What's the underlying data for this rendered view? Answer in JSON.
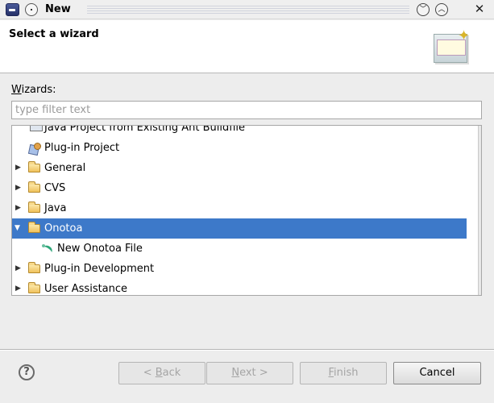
{
  "window": {
    "title": "New"
  },
  "header": {
    "title": "Select a wizard"
  },
  "wizards": {
    "label_prefix": "W",
    "label_rest": "izards:",
    "filter_placeholder": "type filter text",
    "filter_value": ""
  },
  "tree": {
    "items": [
      {
        "label": "Java Project from Existing Ant Buildfile",
        "expander": "",
        "icon": "java-project-icon"
      },
      {
        "label": "Plug-in Project",
        "expander": "",
        "icon": "plugin-project-icon"
      },
      {
        "label": "General",
        "expander": "▶",
        "icon": "folder-icon"
      },
      {
        "label": "CVS",
        "expander": "▶",
        "icon": "folder-icon"
      },
      {
        "label": "Java",
        "expander": "▶",
        "icon": "folder-icon"
      },
      {
        "label": "Onotoa",
        "expander": "▼",
        "icon": "folder-open-icon",
        "selected": true
      },
      {
        "label": "New Onotoa File",
        "expander": "",
        "icon": "onotoa-file-icon"
      },
      {
        "label": "Plug-in Development",
        "expander": "▶",
        "icon": "folder-icon"
      },
      {
        "label": "User Assistance",
        "expander": "▶",
        "icon": "folder-icon"
      }
    ]
  },
  "buttons": {
    "back_symbol": "< ",
    "back_mnemonic": "B",
    "back_rest": "ack",
    "next_mnemonic": "N",
    "next_rest": "ext",
    "next_symbol": " >",
    "finish_mnemonic": "F",
    "finish_rest": "inish",
    "cancel": "Cancel",
    "help_icon": "?"
  },
  "colors": {
    "selection": "#3d79c9",
    "window_bg": "#ededed"
  }
}
